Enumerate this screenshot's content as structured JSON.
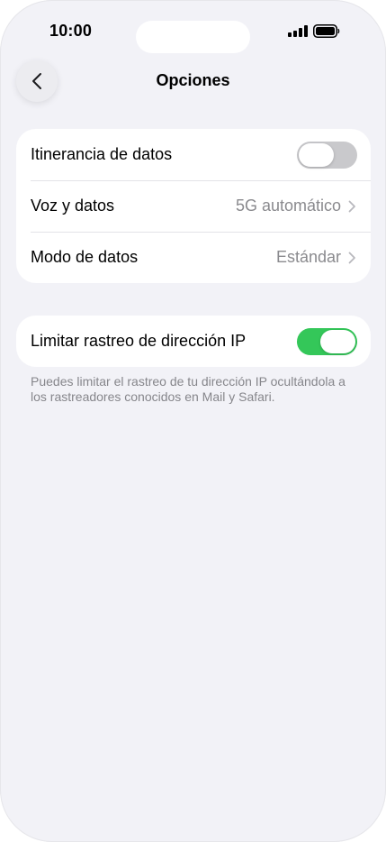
{
  "status_bar": {
    "time": "10:00",
    "signal_icon": "cellular-signal-icon",
    "battery_icon": "battery-icon"
  },
  "nav": {
    "back_icon": "chevron-left-icon",
    "title": "Opciones"
  },
  "group1": {
    "rows": [
      {
        "label": "Itinerancia de datos",
        "control": "toggle",
        "toggle_on": false
      },
      {
        "label": "Voz y datos",
        "value": "5G automático",
        "control": "disclosure"
      },
      {
        "label": "Modo de datos",
        "value": "Estándar",
        "control": "disclosure"
      }
    ]
  },
  "group2": {
    "rows": [
      {
        "label": "Limitar rastreo de dirección IP",
        "control": "toggle",
        "toggle_on": true
      }
    ],
    "footnote": "Puedes limitar el rastreo de tu dirección IP ocultándola a los rastreadores conocidos en Mail y Safari."
  },
  "colors": {
    "background": "#f2f2f7",
    "toggle_on": "#34c759",
    "toggle_off": "#c9c9cc",
    "secondary_text": "#8a8a8e"
  }
}
